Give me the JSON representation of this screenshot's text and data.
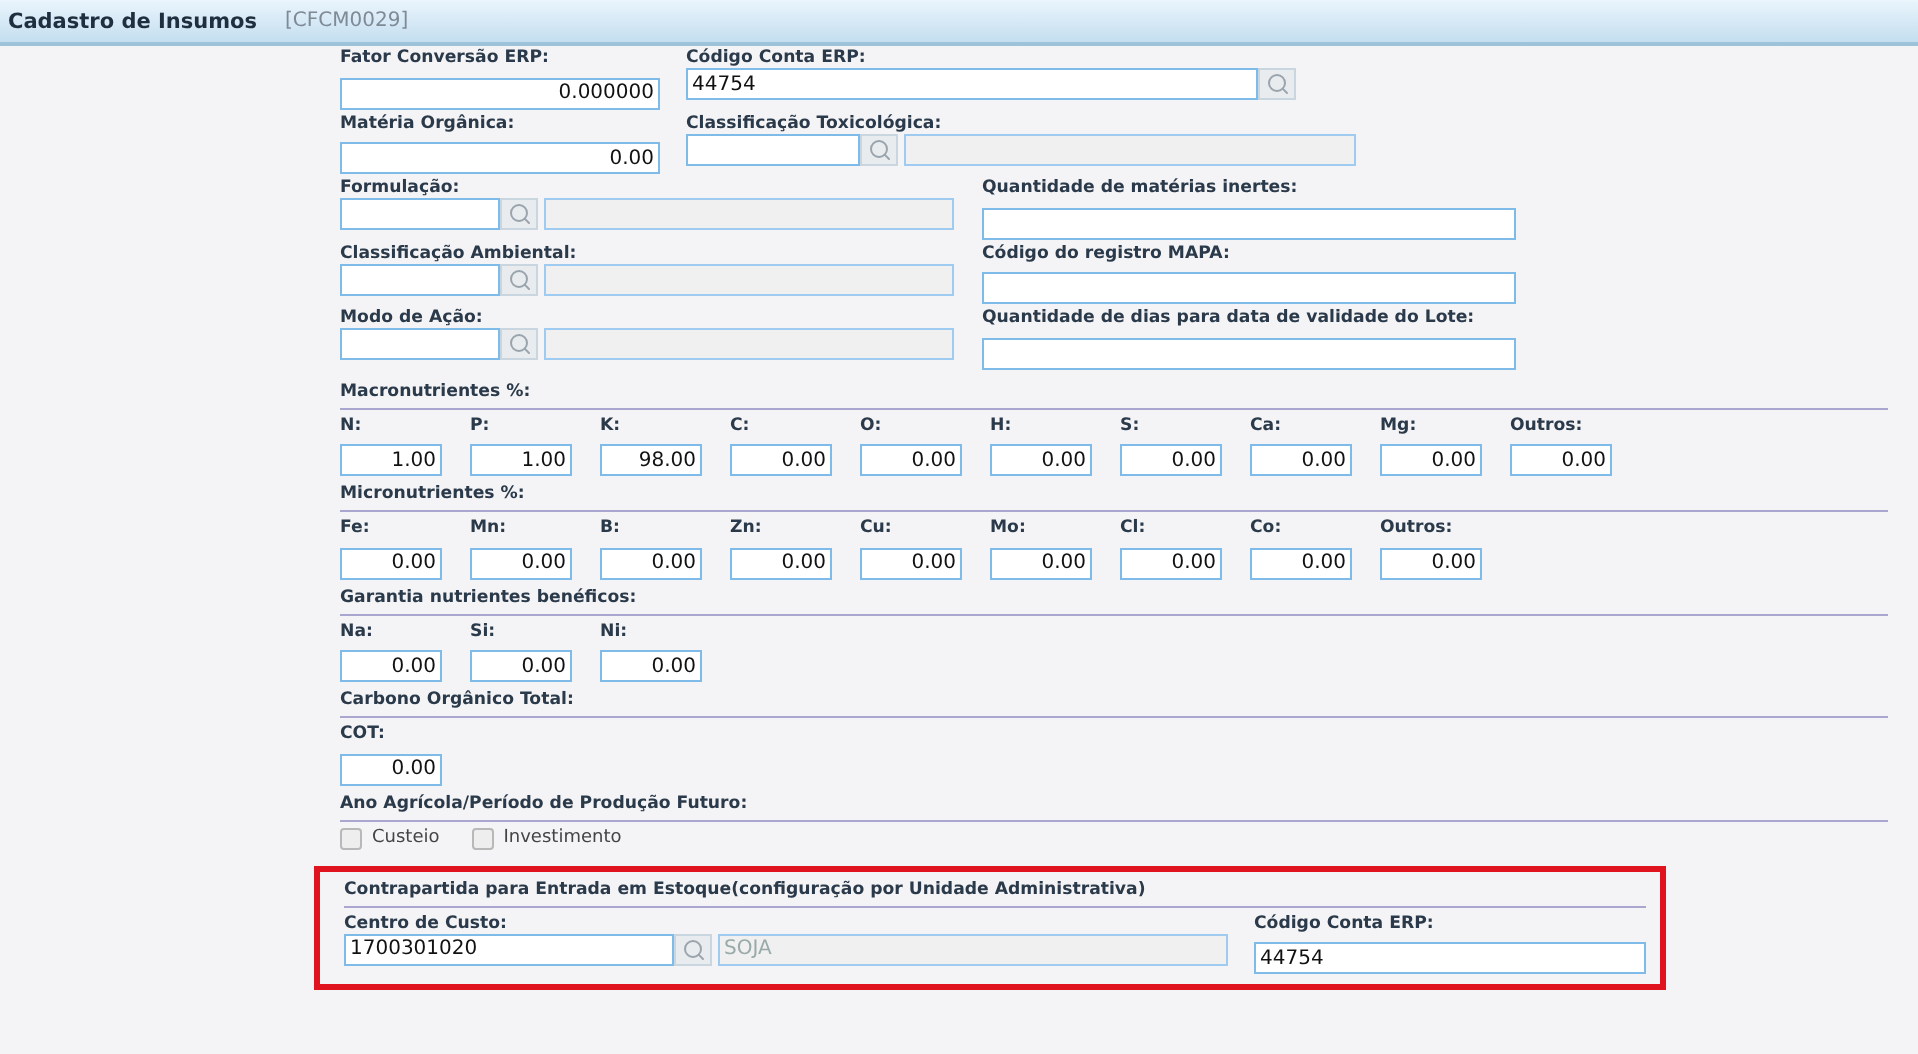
{
  "window": {
    "title": "Cadastro de Insumos",
    "code": "[CFCM0029]"
  },
  "top_rows": [
    {
      "left": {
        "label": "Fator Conversão ERP:",
        "value": "0.000000",
        "kind": "number"
      },
      "right": {
        "label": "Código Conta ERP:",
        "value": "44754",
        "kind": "lookup"
      }
    },
    {
      "left": {
        "label": "Matéria Orgânica:",
        "value": "0.00",
        "kind": "number"
      },
      "right": {
        "label": "Classificação Toxicológica:",
        "kind": "lookup_described"
      }
    }
  ],
  "side_rows": [
    {
      "left": {
        "label": "Formulação:",
        "kind": "lookup_described"
      },
      "right": {
        "label": "Quantidade de matérias inertes:",
        "kind": "text"
      }
    },
    {
      "left": {
        "label": "Classificação Ambiental:",
        "kind": "lookup_described"
      },
      "right": {
        "label": "Código do registro MAPA:",
        "kind": "text"
      }
    },
    {
      "left": {
        "label": "Modo de Ação:",
        "kind": "lookup_described"
      },
      "right": {
        "label": "Quantidade de dias para data de validade do Lote:",
        "kind": "text"
      }
    }
  ],
  "sections": [
    {
      "title": "Macronutrientes %:",
      "kind": "numbers",
      "fields": [
        {
          "label": "N:",
          "value": "1.00"
        },
        {
          "label": "P:",
          "value": "1.00"
        },
        {
          "label": "K:",
          "value": "98.00"
        },
        {
          "label": "C:",
          "value": "0.00"
        },
        {
          "label": "O:",
          "value": "0.00"
        },
        {
          "label": "H:",
          "value": "0.00"
        },
        {
          "label": "S:",
          "value": "0.00"
        },
        {
          "label": "Ca:",
          "value": "0.00"
        },
        {
          "label": "Mg:",
          "value": "0.00"
        },
        {
          "label": "Outros:",
          "value": "0.00"
        }
      ]
    },
    {
      "title": "Micronutrientes %:",
      "kind": "numbers",
      "fields": [
        {
          "label": "Fe:",
          "value": "0.00"
        },
        {
          "label": "Mn:",
          "value": "0.00"
        },
        {
          "label": "B:",
          "value": "0.00"
        },
        {
          "label": "Zn:",
          "value": "0.00"
        },
        {
          "label": "Cu:",
          "value": "0.00"
        },
        {
          "label": "Mo:",
          "value": "0.00"
        },
        {
          "label": "Cl:",
          "value": "0.00"
        },
        {
          "label": "Co:",
          "value": "0.00"
        },
        {
          "label": "Outros:",
          "value": "0.00"
        }
      ]
    },
    {
      "title": "Garantia nutrientes benéficos:",
      "kind": "numbers",
      "fields": [
        {
          "label": "Na:",
          "value": "0.00"
        },
        {
          "label": "Si:",
          "value": "0.00"
        },
        {
          "label": "Ni:",
          "value": "0.00"
        }
      ]
    },
    {
      "title": "Carbono Orgânico Total:",
      "kind": "numbers",
      "fields": [
        {
          "label": "COT:",
          "value": "0.00"
        }
      ]
    },
    {
      "title": "Ano Agrícola/Período de Produção Futuro:",
      "kind": "checkboxes",
      "options": [
        {
          "label": "Custeio",
          "checked": false
        },
        {
          "label": "Investimento",
          "checked": false
        }
      ]
    },
    {
      "title": "Contrapartida para Entrada em Estoque(configuração por Unidade Administrativa)",
      "kind": "cost_center",
      "highlighted": true,
      "cost_center": {
        "label": "Centro de Custo:",
        "value": "1700301020",
        "description": "SOJA"
      },
      "erp_account": {
        "label": "Código Conta ERP:",
        "value": "44754"
      }
    }
  ]
}
